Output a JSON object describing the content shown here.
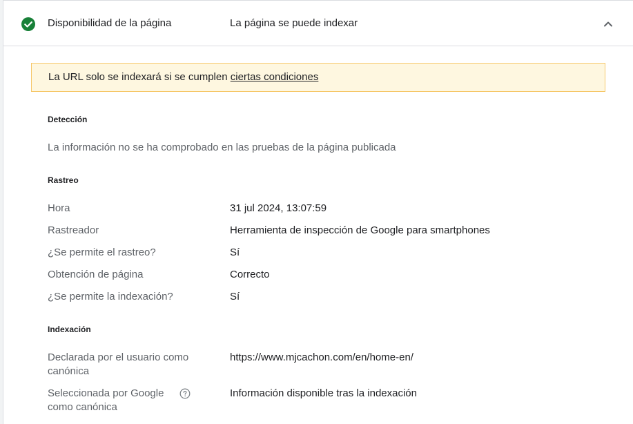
{
  "header": {
    "title": "Disponibilidad de la página",
    "status": "La página se puede indexar",
    "status_icon": "check-circle-icon",
    "status_color": "#188038",
    "collapse_icon": "chevron-up-icon"
  },
  "notice": {
    "text": "La URL solo se indexará si se cumplen ",
    "link": "ciertas condiciones",
    "background": "#fef7e0",
    "border": "#f6c768"
  },
  "discovery": {
    "title": "Detección",
    "message": "La información no se ha comprobado en las pruebas de la página publicada"
  },
  "crawl": {
    "title": "Rastreo",
    "rows": [
      {
        "label": "Hora",
        "value": "31 jul 2024, 13:07:59"
      },
      {
        "label": "Rastreador",
        "value": "Herramienta de inspección de Google para smartphones"
      },
      {
        "label": "¿Se permite el rastreo?",
        "value": "Sí"
      },
      {
        "label": "Obtención de página",
        "value": "Correcto"
      },
      {
        "label": "¿Se permite la indexación?",
        "value": "Sí"
      }
    ]
  },
  "indexing": {
    "title": "Indexación",
    "rows": [
      {
        "label": "Declarada por el usuario como canónica",
        "value": "https://www.mjcachon.com/en/home-en/"
      },
      {
        "label": "Seleccionada por Google como canónica",
        "value": "Información disponible tras la indexación",
        "help_icon": "help-circle-icon"
      }
    ]
  }
}
